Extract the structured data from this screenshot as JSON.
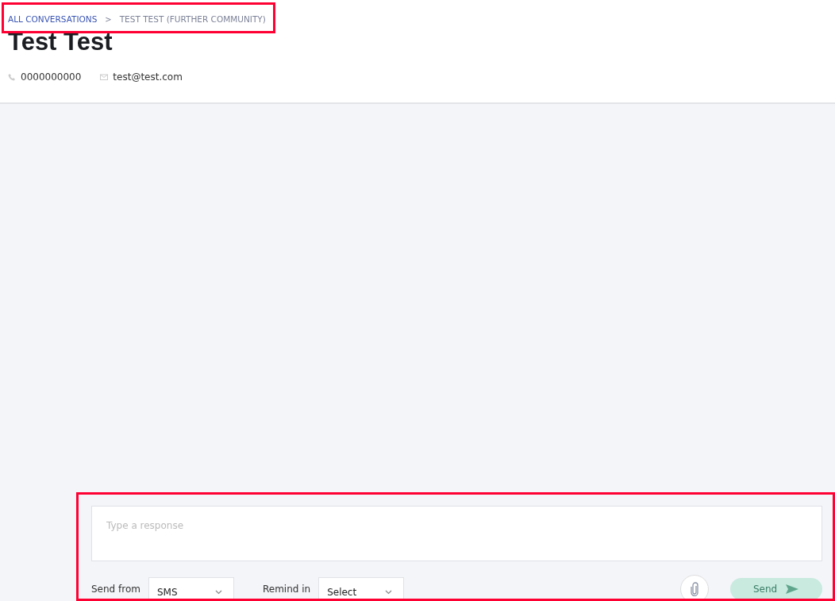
{
  "breadcrumb": [
    {
      "label": "ALL CONVERSATIONS",
      "kind": "link"
    },
    {
      "label": "TEST TEST (FURTHER COMMUNITY)",
      "kind": "current"
    }
  ],
  "breadcrumb_separator": ">",
  "contact": {
    "name": "Test Test",
    "phone": "0000000000",
    "email": "test@test.com"
  },
  "composer": {
    "placeholder": "Type a response",
    "send_from": {
      "label": "Send from",
      "value": "SMS"
    },
    "remind_in": {
      "label": "Remind in",
      "value": "Select"
    },
    "send_button": {
      "label": "Send",
      "disabled": true
    }
  }
}
